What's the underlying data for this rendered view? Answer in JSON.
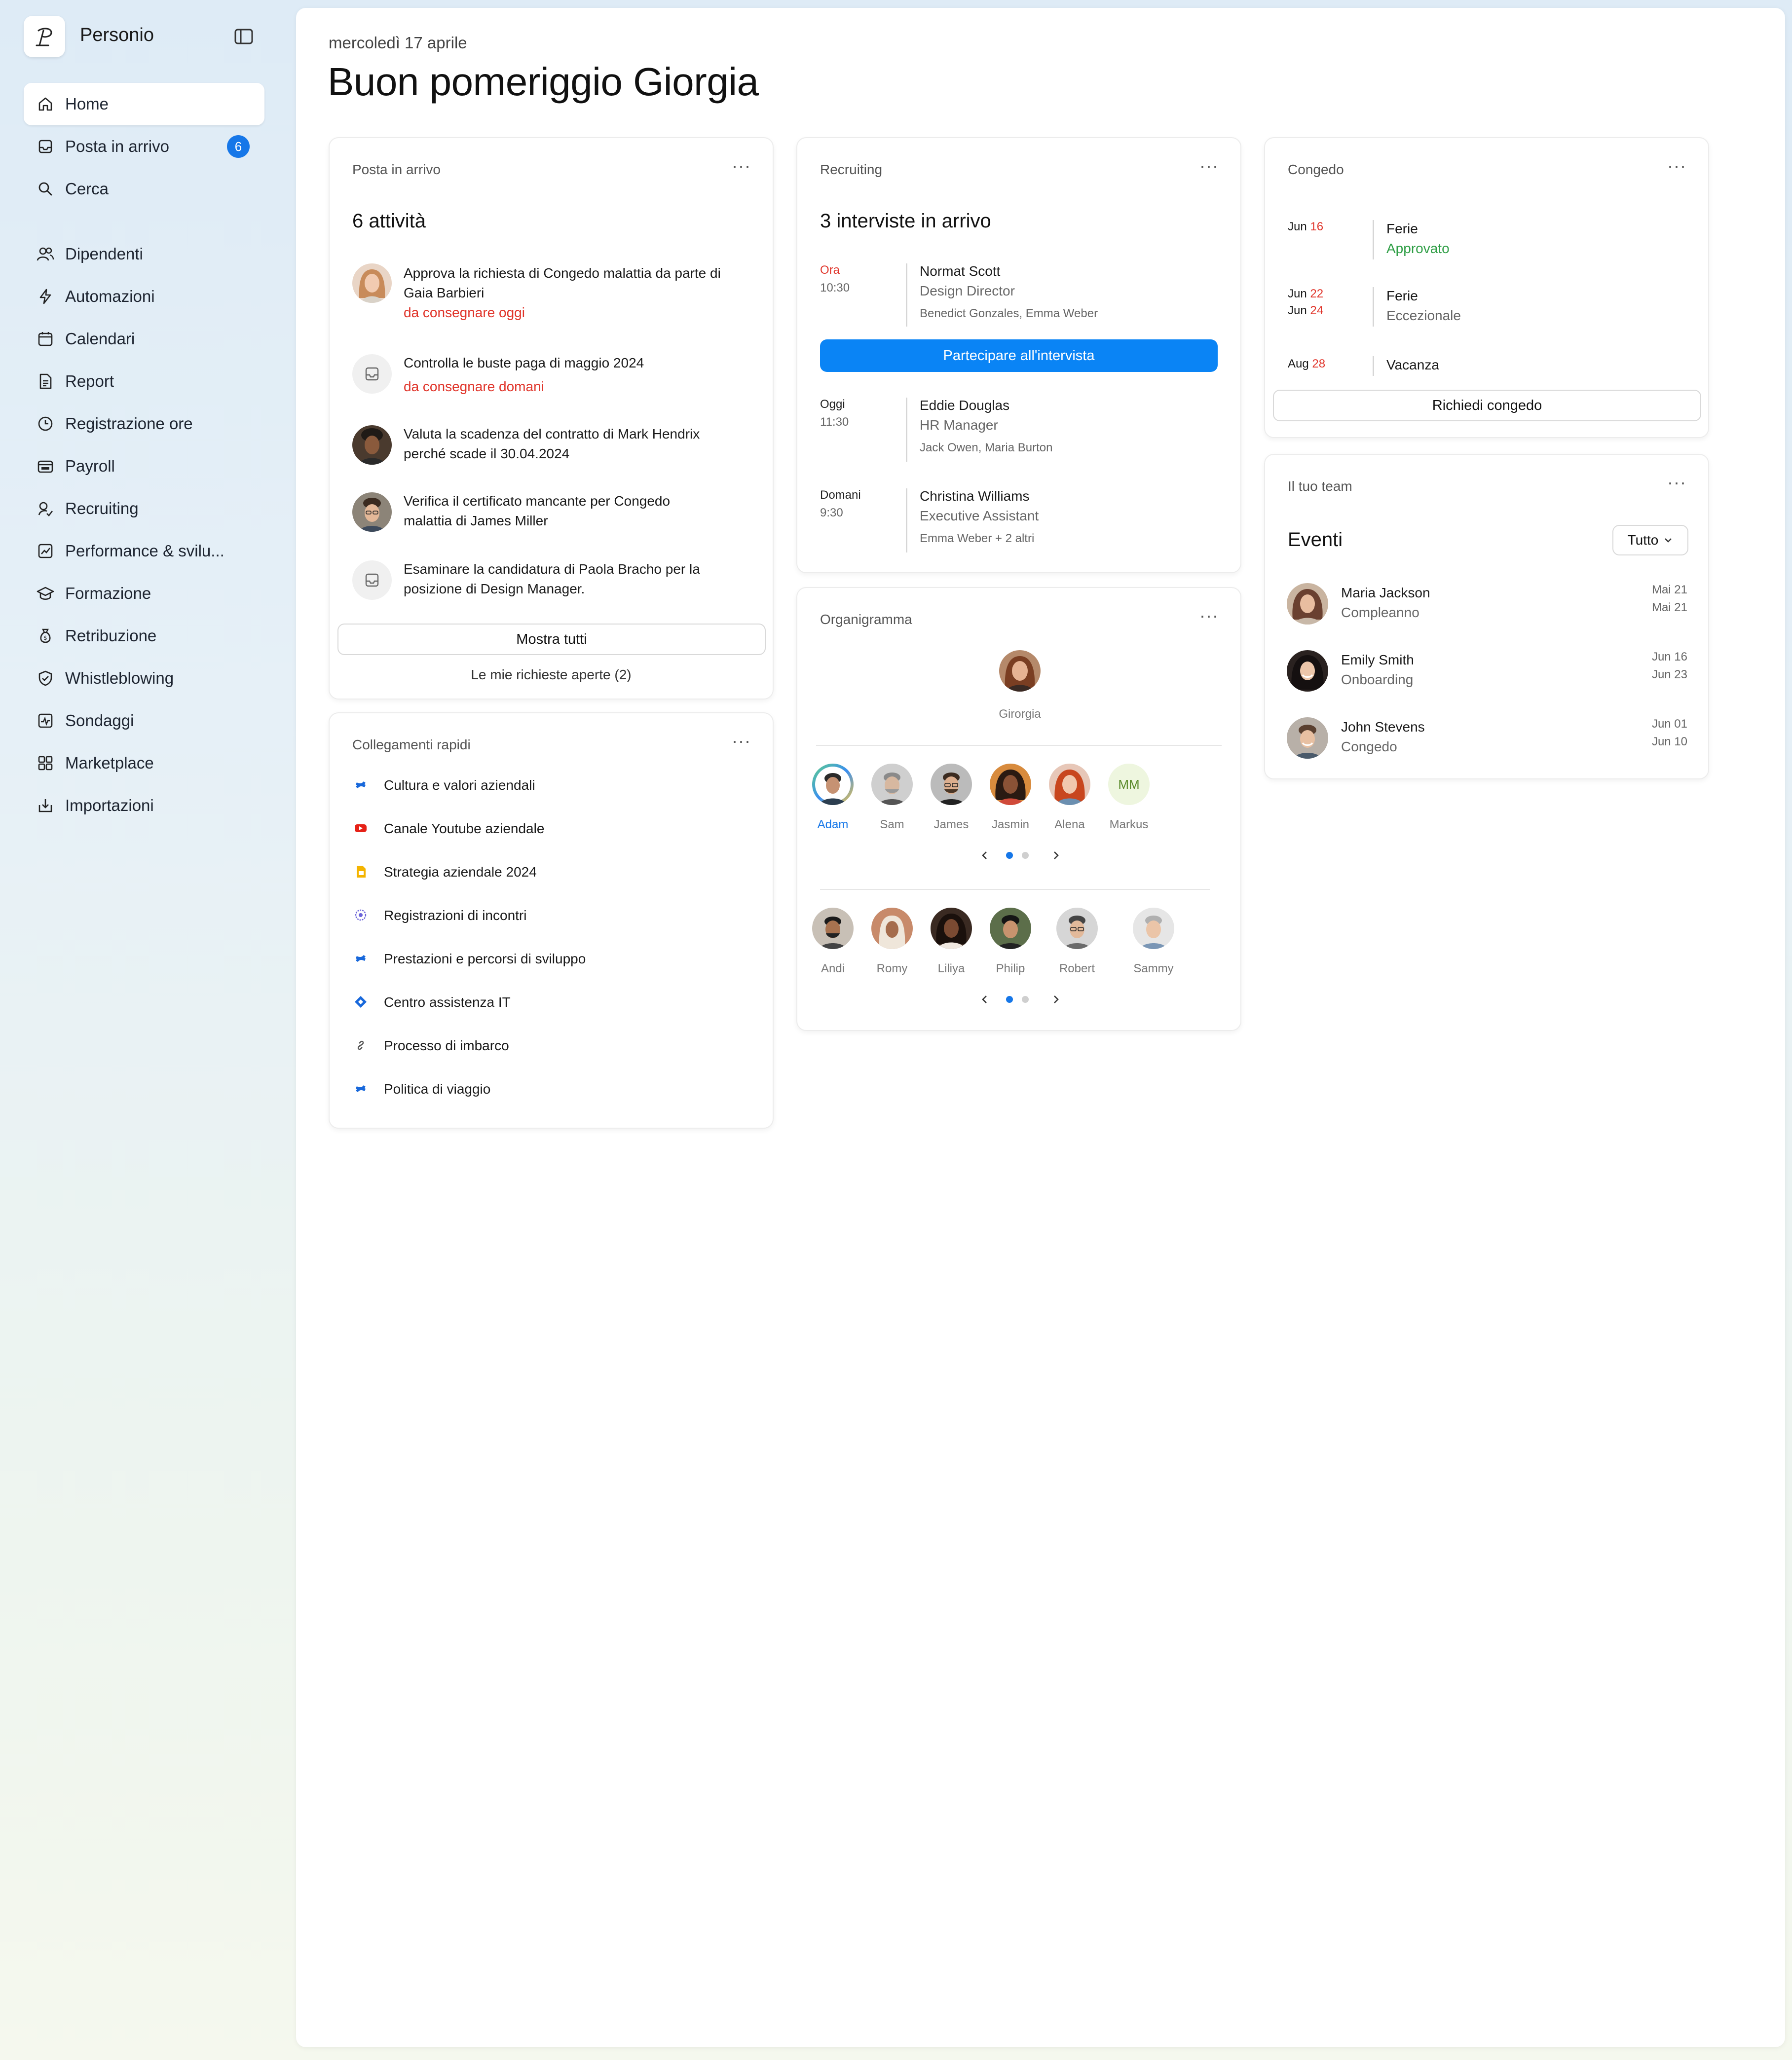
{
  "app": {
    "name": "Personio"
  },
  "nav": {
    "items": [
      {
        "label": "Home"
      },
      {
        "label": "Posta in arrivo",
        "badge": "6"
      },
      {
        "label": "Cerca"
      },
      {
        "label": "Dipendenti"
      },
      {
        "label": "Automazioni"
      },
      {
        "label": "Calendari"
      },
      {
        "label": "Report"
      },
      {
        "label": "Registrazione ore"
      },
      {
        "label": "Payroll"
      },
      {
        "label": "Recruiting"
      },
      {
        "label": "Performance & svilu..."
      },
      {
        "label": "Formazione"
      },
      {
        "label": "Retribuzione"
      },
      {
        "label": "Whistleblowing"
      },
      {
        "label": "Sondaggi"
      },
      {
        "label": "Marketplace"
      },
      {
        "label": "Importazioni"
      }
    ]
  },
  "header": {
    "date": "mercoledì 17 aprile",
    "greeting": "Buon pomeriggio Giorgia"
  },
  "inbox": {
    "title": "Posta in arrivo",
    "count": "6 attività",
    "tasks": [
      {
        "text": "Approva la richiesta di Congedo malattia da parte di Gaia Barbieri",
        "due": "da consegnare oggi"
      },
      {
        "text": "Controlla le buste paga di maggio 2024",
        "due": "da consegnare domani"
      },
      {
        "text": "Valuta la scadenza del contratto di Mark Hendrix perché scade il 30.04.2024",
        "due": ""
      },
      {
        "text": "Verifica il certificato mancante per Congedo malattia di James Miller",
        "due": ""
      },
      {
        "text": "Esaminare la candidatura di Paola Bracho per la posizione di Design Manager.",
        "due": ""
      }
    ],
    "show_all": "Mostra tutti",
    "open_requests": "Le mie richieste aperte (2)"
  },
  "quick_links": {
    "title": "Collegamenti rapidi",
    "items": [
      {
        "label": "Cultura e valori aziendali",
        "icon": "confluence-icon"
      },
      {
        "label": "Canale Youtube aziendale",
        "icon": "youtube-icon"
      },
      {
        "label": "Strategia aziendale 2024",
        "icon": "google-slides-icon"
      },
      {
        "label": "Registrazioni di incontri",
        "icon": "meeting-recording-icon"
      },
      {
        "label": "Prestazioni e percorsi di sviluppo",
        "icon": "confluence-icon"
      },
      {
        "label": "Centro assistenza IT",
        "icon": "jira-icon"
      },
      {
        "label": "Processo di imbarco",
        "icon": "link-icon"
      },
      {
        "label": "Politica di viaggio",
        "icon": "confluence-icon"
      }
    ]
  },
  "recruiting": {
    "title": "Recruiting",
    "heading": "3 interviste in arrivo",
    "interviews": [
      {
        "when": "Ora",
        "time": "10:30",
        "name": "Normat Scott",
        "role": "Design Director",
        "panel": "Benedict Gonzales, Emma Weber"
      },
      {
        "when": "Oggi",
        "time": "11:30",
        "name": "Eddie Douglas",
        "role": "HR Manager",
        "panel": "Jack Owen, Maria Burton"
      },
      {
        "when": "Domani",
        "time": "9:30",
        "name": "Christina Williams",
        "role": "Executive Assistant",
        "panel": "Emma Weber + 2 altri"
      }
    ],
    "join_button": "Partecipare all'intervista"
  },
  "org": {
    "title": "Organigramma",
    "root": "Girorgia",
    "row1": [
      {
        "name": "Adam"
      },
      {
        "name": "Sam"
      },
      {
        "name": "James"
      },
      {
        "name": "Jasmin"
      },
      {
        "name": "Alena"
      },
      {
        "name": "Markus",
        "initials": "MM"
      }
    ],
    "row2": [
      {
        "name": "Andi"
      },
      {
        "name": "Romy"
      },
      {
        "name": "Liliya"
      },
      {
        "name": "Philip"
      },
      {
        "name": "Robert"
      },
      {
        "name": "Sammy"
      }
    ]
  },
  "leave": {
    "title": "Congedo",
    "entries": [
      {
        "m1": "Jun",
        "d1": "16",
        "m2": "",
        "d2": "",
        "type": "Ferie",
        "status": "Approvato"
      },
      {
        "m1": "Jun",
        "d1": "22",
        "m2": "Jun",
        "d2": "24",
        "type": "Ferie",
        "status": "Eccezionale"
      },
      {
        "m1": "Aug",
        "d1": "28",
        "m2": "",
        "d2": "",
        "type": "Vacanza",
        "status": ""
      }
    ],
    "request_button": "Richiedi congedo"
  },
  "team": {
    "title": "Il tuo team",
    "heading": "Eventi",
    "filter": "Tutto",
    "events": [
      {
        "name": "Maria Jackson",
        "event": "Compleanno",
        "date1": "Mai 21",
        "date2": "Mai 21"
      },
      {
        "name": "Emily Smith",
        "event": "Onboarding",
        "date1": "Jun 16",
        "date2": "Jun 23"
      },
      {
        "name": "John Stevens",
        "event": "Congedo",
        "date1": "Jun 01",
        "date2": "Jun 10"
      }
    ]
  },
  "colors": {
    "accent": "#0a84f5",
    "badge": "#1677e8",
    "urgent": "#e0352b",
    "approved": "#2e9e45"
  }
}
